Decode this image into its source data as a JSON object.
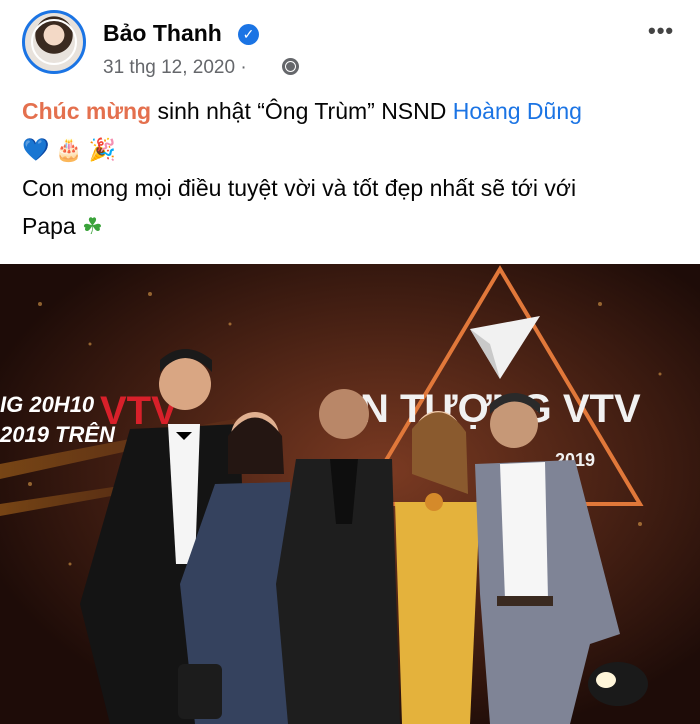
{
  "post": {
    "author": "Bảo Thanh",
    "date": "31 thg 12, 2020 ·",
    "text_highlight": "Chúc mừng",
    "text_line1_rest": " sinh nhật “Ông Trùm” NSND ",
    "mention": "Hoàng Dũng",
    "emoji_line": [
      "💙",
      "🎂",
      "🎉"
    ],
    "text_line3": "Con mong mọi điều tuyệt vời và tốt đẹp nhất sẽ tới với",
    "text_line4": "Papa",
    "clover": "☘"
  },
  "photo": {
    "banner_left_1": "IG 20H10",
    "banner_left_2": "2019 TRÊN",
    "banner_vtv": "VTV",
    "banner_right": "N TƯỢNG VTV",
    "banner_year": "2019"
  },
  "icons": {
    "verified": "verified-badge-icon",
    "globe": "globe-icon",
    "more": "more-options-icon"
  },
  "colors": {
    "brand_blue": "#1b74e4",
    "highlight": "#e4704e",
    "meta_gray": "#65676b"
  }
}
